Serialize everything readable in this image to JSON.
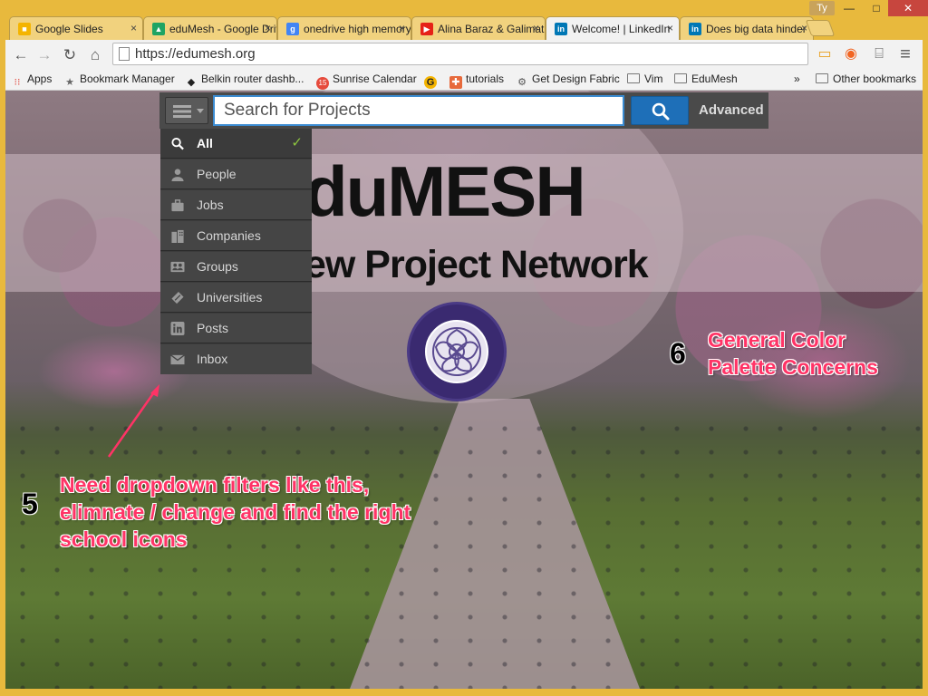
{
  "window": {
    "user_chip": "Ty",
    "min_glyph": "—",
    "max_glyph": "□",
    "close_glyph": "✕"
  },
  "tabs": [
    {
      "title": "Google Slides",
      "favicon": "slides-icon",
      "color": "#f4b400",
      "glyph": "■",
      "active": false
    },
    {
      "title": "eduMesh - Google Drive",
      "favicon": "drive-icon",
      "color": "#1fa463",
      "glyph": "▲",
      "active": false
    },
    {
      "title": "onedrive high memory",
      "favicon": "google-search-icon",
      "color": "#4285f4",
      "glyph": "g",
      "active": false
    },
    {
      "title": "Alina Baraz & Galimatias",
      "favicon": "youtube-icon",
      "color": "#e62117",
      "glyph": "▶",
      "active": false
    },
    {
      "title": "Welcome! | LinkedIn",
      "favicon": "linkedin-icon",
      "color": "#0077b5",
      "glyph": "in",
      "active": true
    },
    {
      "title": "Does big data hinder",
      "favicon": "linkedin-icon",
      "color": "#0077b5",
      "glyph": "in",
      "active": false
    }
  ],
  "tab_close_glyph": "×",
  "toolbar": {
    "back": "←",
    "forward": "→",
    "reload": "↻",
    "home": "⌂",
    "url": "https://edumesh.org",
    "menu": "≡",
    "ext_folder": "▭",
    "ext_orange": "◉",
    "cast": "⌸"
  },
  "bookmarks": [
    {
      "label": "Apps",
      "icon": "apps-grid-icon",
      "glyph": "⁝⁝",
      "color": "#e0453a"
    },
    {
      "label": "Bookmark Manager",
      "icon": "star-icon",
      "glyph": "★",
      "color": "#666"
    },
    {
      "label": "Belkin router dashb...",
      "icon": "belkin-icon",
      "glyph": "◆",
      "color": "#222"
    },
    {
      "label": "Sunrise Calendar",
      "icon": "sunrise-calendar-icon",
      "glyph": "15",
      "color": "#e64b3c"
    },
    {
      "label": "",
      "icon": "g-icon",
      "glyph": "G",
      "color": "#f4b400"
    },
    {
      "label": "tutorials",
      "icon": "plus-icon",
      "glyph": "✚",
      "color": "#e76a3c"
    },
    {
      "label": "Get Design Fabric",
      "icon": "gear-icon",
      "glyph": "⚙",
      "color": "#555"
    },
    {
      "label": "Vim",
      "icon": "folder-icon",
      "glyph": "",
      "color": "#777"
    },
    {
      "label": "EduMesh",
      "icon": "folder-icon",
      "glyph": "",
      "color": "#777"
    }
  ],
  "bookmarks_overflow": "»",
  "bookmarks_other": "Other bookmarks",
  "site": {
    "search": {
      "placeholder": "Search for Projects",
      "advanced_label": "Advanced"
    },
    "dropdown": [
      {
        "label": "All",
        "icon": "search-icon",
        "selected": true
      },
      {
        "label": "People",
        "icon": "person-icon",
        "selected": false
      },
      {
        "label": "Jobs",
        "icon": "briefcase-icon",
        "selected": false
      },
      {
        "label": "Companies",
        "icon": "building-icon",
        "selected": false
      },
      {
        "label": "Groups",
        "icon": "group-icon",
        "selected": false
      },
      {
        "label": "Universities",
        "icon": "graduation-cap-icon",
        "selected": false
      },
      {
        "label": "Posts",
        "icon": "linkedin-icon",
        "selected": false
      },
      {
        "label": "Inbox",
        "icon": "envelope-icon",
        "selected": false
      }
    ],
    "check_glyph": "✓",
    "hero_title": "duMESH",
    "hero_subtitle": "ew Project Network"
  },
  "annotations": {
    "note5_number": "5",
    "note5_text": "Need dropdown filters like this, elimnate / change and find the right school icons",
    "note6_number": "6",
    "note6_text": "General Color Palette Concerns",
    "accent_color": "#ff3366"
  }
}
